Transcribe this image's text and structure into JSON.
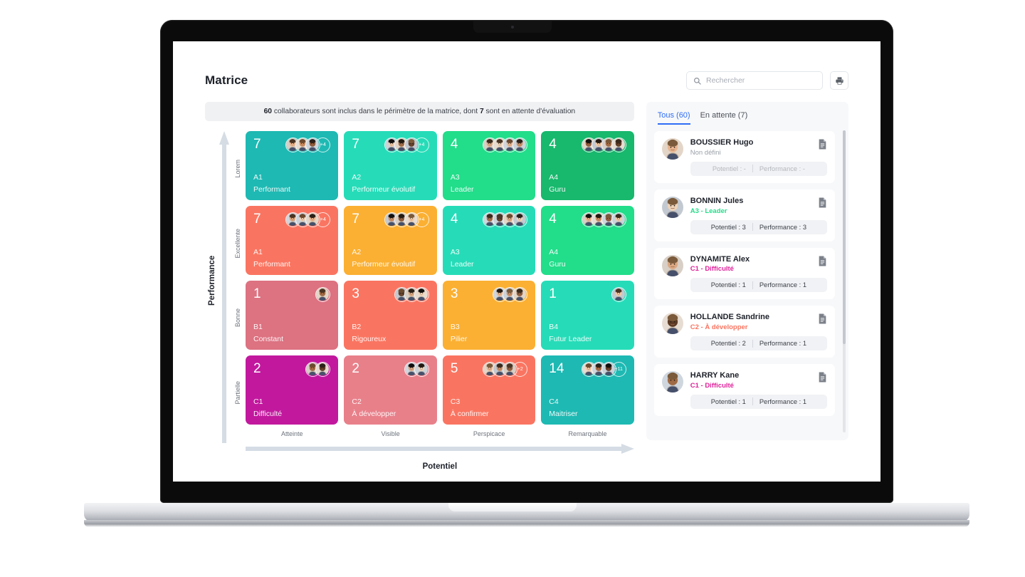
{
  "header": {
    "title": "Matrice",
    "search_placeholder": "Rechercher",
    "search_value": "",
    "search_icon": "search-icon",
    "print_icon": "printer-icon"
  },
  "info_banner": {
    "total": "60",
    "text_mid": " collaborateurs sont inclus dans le périmètre de la matrice, dont ",
    "pending": "7",
    "text_end": " sont en attente d'évaluation"
  },
  "matrix": {
    "y_axis_title": "Performance",
    "x_axis_title": "Potentiel",
    "y_ticks": [
      "Lorem",
      "Excellente",
      "Bonne",
      "Partielle"
    ],
    "x_ticks": [
      "Atteinte",
      "Visible",
      "Perspicace",
      "Remarquable"
    ],
    "cells": [
      {
        "count": "7",
        "code": "A1",
        "label": "Performant",
        "color": "#1eb9b3",
        "avatars": 3,
        "more": "+4"
      },
      {
        "count": "7",
        "code": "A2",
        "label": "Performeur évolutif",
        "color": "#26dcb8",
        "avatars": 3,
        "more": "+4"
      },
      {
        "count": "4",
        "code": "A3",
        "label": "Leader",
        "color": "#22dd8a",
        "avatars": 4,
        "more": ""
      },
      {
        "count": "4",
        "code": "A4",
        "label": "Guru",
        "color": "#18b86d",
        "avatars": 4,
        "more": ""
      },
      {
        "count": "7",
        "code": "A1",
        "label": "Performant",
        "color": "#fa7561",
        "avatars": 3,
        "more": "+4"
      },
      {
        "count": "7",
        "code": "A2",
        "label": "Performeur évolutif",
        "color": "#fbb033",
        "avatars": 3,
        "more": "+4"
      },
      {
        "count": "4",
        "code": "A3",
        "label": "Leader",
        "color": "#26dcb8",
        "avatars": 4,
        "more": ""
      },
      {
        "count": "4",
        "code": "A4",
        "label": "Guru",
        "color": "#22dd8a",
        "avatars": 4,
        "more": ""
      },
      {
        "count": "1",
        "code": "B1",
        "label": "Constant",
        "color": "#dd7281",
        "avatars": 1,
        "more": ""
      },
      {
        "count": "3",
        "code": "B2",
        "label": "Rigoureux",
        "color": "#fa7561",
        "avatars": 3,
        "more": ""
      },
      {
        "count": "3",
        "code": "B3",
        "label": "Pilier",
        "color": "#fbb033",
        "avatars": 3,
        "more": ""
      },
      {
        "count": "1",
        "code": "B4",
        "label": "Futur Leader",
        "color": "#26dcb8",
        "avatars": 1,
        "more": ""
      },
      {
        "count": "2",
        "code": "C1",
        "label": "Difficulté",
        "color": "#c2189e",
        "avatars": 2,
        "more": ""
      },
      {
        "count": "2",
        "code": "C2",
        "label": "À développer",
        "color": "#e8808a",
        "avatars": 2,
        "more": ""
      },
      {
        "count": "5",
        "code": "C3",
        "label": "À confirmer",
        "color": "#fa7561",
        "avatars": 3,
        "more": "+2"
      },
      {
        "count": "14",
        "code": "C4",
        "label": "Maitriser",
        "color": "#1eb9b3",
        "avatars": 3,
        "more": "+11"
      }
    ]
  },
  "list": {
    "tabs": [
      {
        "label": "Tous (60)",
        "active": true
      },
      {
        "label": "En attente (7)",
        "active": false
      }
    ],
    "doc_icon": "document-icon",
    "people": [
      {
        "name": "BOUSSIER Hugo",
        "status": "Non défini",
        "status_color": "#9aa0a8",
        "potentiel_label": "Potentiel : -",
        "performance_label": "Performance : -",
        "muted": true,
        "avatar_a": "#6e5a4a",
        "avatar_b": "#2c3e46"
      },
      {
        "name": "BONNIN Jules",
        "status": "A3 - Leader",
        "status_color": "#22dd8a",
        "potentiel_label": "Potentiel : 3",
        "performance_label": "Performance : 3",
        "muted": false,
        "avatar_a": "#9a8a7a",
        "avatar_b": "#4e4238"
      },
      {
        "name": "DYNAMITE Alex",
        "status": "C1 - Difficulté",
        "status_color": "#e0229a",
        "potentiel_label": "Potentiel : 1",
        "performance_label": "Performance : 1",
        "muted": false,
        "avatar_a": "#8d7a68",
        "avatar_b": "#3a332c"
      },
      {
        "name": "HOLLANDE Sandrine",
        "status": "C2 - À développer",
        "status_color": "#fa7561",
        "potentiel_label": "Potentiel : 2",
        "performance_label": "Performance : 1",
        "muted": false,
        "avatar_a": "#e3b9a8",
        "avatar_b": "#8a5f52"
      },
      {
        "name": "HARRY Kane",
        "status": "C1 - Difficulté",
        "status_color": "#e0229a",
        "potentiel_label": "Potentiel : 1",
        "performance_label": "Performance : 1",
        "muted": false,
        "avatar_a": "#6f5c3f",
        "avatar_b": "#2f2a22"
      }
    ]
  }
}
